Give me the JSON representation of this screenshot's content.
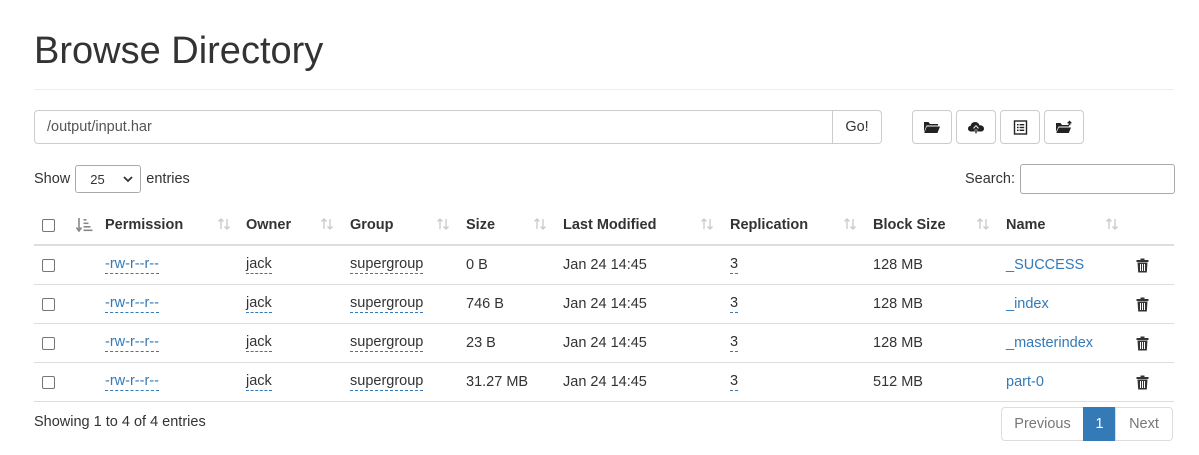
{
  "title": "Browse Directory",
  "path_bar": {
    "value": "/output/input.har",
    "go_label": "Go!"
  },
  "toolbar": {
    "icons": [
      "folder-open-icon",
      "cloud-upload-icon",
      "list-alt-icon",
      "folder-upload-icon"
    ]
  },
  "length": {
    "show_label": "Show",
    "selected": "25",
    "entries_label": "entries"
  },
  "search": {
    "label": "Search:",
    "value": ""
  },
  "table": {
    "headers": {
      "permission": "Permission",
      "owner": "Owner",
      "group": "Group",
      "size": "Size",
      "last_modified": "Last Modified",
      "replication": "Replication",
      "block_size": "Block Size",
      "name": "Name"
    },
    "rows": [
      {
        "permission": "-rw-r--r--",
        "owner": "jack",
        "group": "supergroup",
        "size": "0 B",
        "last_modified": "Jan 24 14:45",
        "replication": "3",
        "block_size": "128 MB",
        "name": "_SUCCESS"
      },
      {
        "permission": "-rw-r--r--",
        "owner": "jack",
        "group": "supergroup",
        "size": "746 B",
        "last_modified": "Jan 24 14:45",
        "replication": "3",
        "block_size": "128 MB",
        "name": "_index"
      },
      {
        "permission": "-rw-r--r--",
        "owner": "jack",
        "group": "supergroup",
        "size": "23 B",
        "last_modified": "Jan 24 14:45",
        "replication": "3",
        "block_size": "128 MB",
        "name": "_masterindex"
      },
      {
        "permission": "-rw-r--r--",
        "owner": "jack",
        "group": "supergroup",
        "size": "31.27 MB",
        "last_modified": "Jan 24 14:45",
        "replication": "3",
        "block_size": "512 MB",
        "name": "part-0"
      }
    ]
  },
  "footer": {
    "info": "Showing 1 to 4 of 4 entries",
    "pagination": {
      "previous": "Previous",
      "current": "1",
      "next": "Next"
    }
  },
  "colors": {
    "link": "#337ab7",
    "active_page": "#337ab7"
  }
}
